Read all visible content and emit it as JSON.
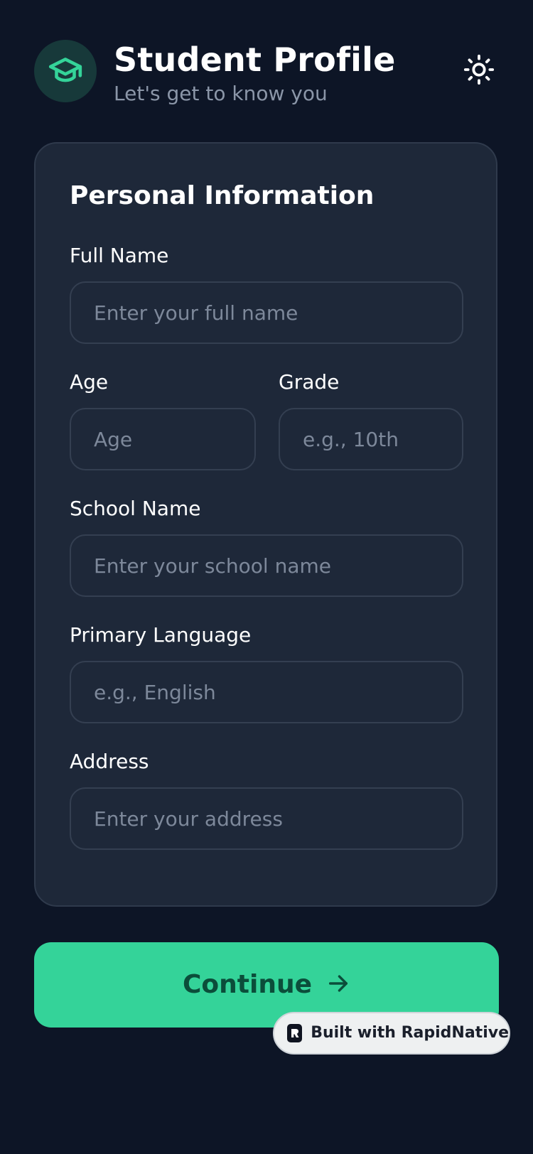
{
  "header": {
    "title": "Student Profile",
    "subtitle": "Let's get to know you",
    "avatar_icon": "graduation-cap-icon",
    "theme_icon": "sun-icon"
  },
  "form": {
    "section_title": "Personal Information",
    "fields": {
      "full_name": {
        "label": "Full Name",
        "placeholder": "Enter your full name",
        "value": ""
      },
      "age": {
        "label": "Age",
        "placeholder": "Age",
        "value": ""
      },
      "grade": {
        "label": "Grade",
        "placeholder": "e.g., 10th",
        "value": ""
      },
      "school_name": {
        "label": "School Name",
        "placeholder": "Enter your school name",
        "value": ""
      },
      "primary_language": {
        "label": "Primary Language",
        "placeholder": "e.g., English",
        "value": ""
      },
      "address": {
        "label": "Address",
        "placeholder": "Enter your address",
        "value": ""
      }
    }
  },
  "actions": {
    "continue_label": "Continue",
    "continue_icon": "arrow-right-icon"
  },
  "badge": {
    "label": "Built with RapidNative",
    "icon": "rapidnative-logo-icon"
  },
  "colors": {
    "background": "#0d1526",
    "card": "#1e2839",
    "accent": "#34d399",
    "accent_text": "#0b4d3a",
    "muted_text": "#8b96a8"
  }
}
